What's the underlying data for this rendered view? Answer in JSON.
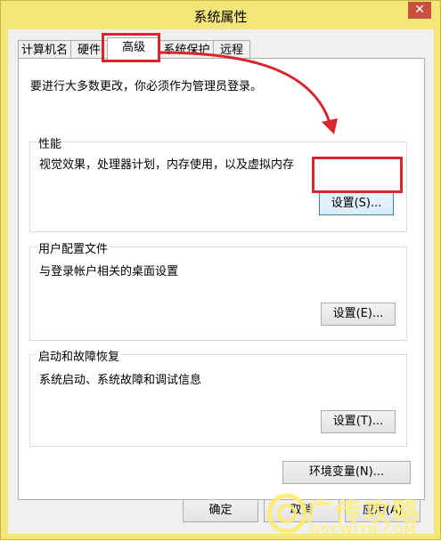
{
  "window": {
    "title": "系统属性",
    "close_glyph": "✕"
  },
  "tabs": [
    {
      "label": "计算机名"
    },
    {
      "label": "硬件"
    },
    {
      "label": "高级"
    },
    {
      "label": "系统保护"
    },
    {
      "label": "远程"
    }
  ],
  "active_tab": "高级",
  "panel": {
    "intro": "要进行大多数更改，你必须作为管理员登录。",
    "performance": {
      "label": "性能",
      "description": "视觉效果，处理器计划，内存使用，以及虚拟内存",
      "button": "设置(S)..."
    },
    "user_profiles": {
      "label": "用户配置文件",
      "description": "与登录帐户相关的桌面设置",
      "button": "设置(E)..."
    },
    "startup_recovery": {
      "label": "启动和故障恢复",
      "description": "系统启动、系统故障和调试信息",
      "button": "设置(T)..."
    },
    "env_button": "环境变量(N)..."
  },
  "footer": {
    "ok": "确定",
    "cancel": "取消",
    "apply": "应用(A)"
  },
  "watermark": {
    "text": "广传攻略",
    "sub": "GGCWITH.COM"
  },
  "colors": {
    "window_frame": "#f5e67a",
    "highlight": "#d7262e"
  }
}
